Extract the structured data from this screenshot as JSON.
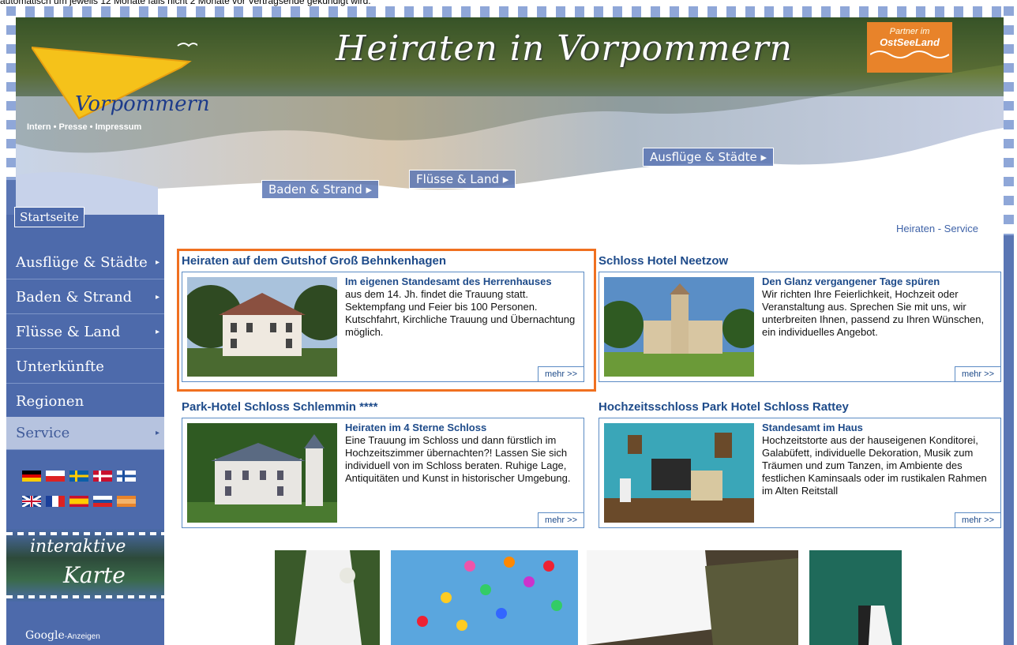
{
  "top_text": "automatisch um jeweils 12 Monate falls nicht 2 Monate vor Vertragsende gekündigt wird.",
  "header": {
    "title": "Heiraten in Vorpommern",
    "logo": "Vorpommern",
    "intern_links": "Intern • Presse • Impressum",
    "partner_line1": "Partner im",
    "partner_line2": "OstSeeLand",
    "buttons": {
      "baden": "Baden & Strand ▸",
      "fluesse": "Flüsse & Land ▸",
      "ausfluege": "Ausflüge & Städte ▸"
    }
  },
  "sidebar": {
    "start": "Startseite",
    "items": [
      {
        "label": "Ausflüge & Städte",
        "arrow": "▸"
      },
      {
        "label": "Baden & Strand",
        "arrow": "▸"
      },
      {
        "label": "Flüsse & Land",
        "arrow": "▸"
      },
      {
        "label": "Unterkünfte",
        "arrow": ""
      },
      {
        "label": "Regionen",
        "arrow": ""
      },
      {
        "label": "Service",
        "arrow": "▸"
      }
    ],
    "karte_line1": "interaktive",
    "karte_line2": "Karte",
    "google": "Google",
    "google_small": "-Anzeigen"
  },
  "breadcrumb": "Heiraten - Service",
  "cards": [
    {
      "title": "Heiraten auf dem Gutshof Groß Behnkenhagen",
      "subtitle": "Im eigenen Standesamt des Herrenhauses",
      "text": "aus dem 14. Jh. findet die Trauung statt. Sektempfang und Feier bis 100 Personen. Kutschfahrt, Kirchliche Trauung und Übernachtung möglich.",
      "more": "mehr >>"
    },
    {
      "title": "Schloss Hotel Neetzow",
      "subtitle": "Den Glanz vergangener Tage spüren",
      "text": "Wir richten Ihre Feierlichkeit, Hochzeit oder Veranstaltung aus. Sprechen Sie mit uns, wir unterbreiten Ihnen, passend zu Ihren Wünschen, ein individuelles Angebot.",
      "more": "mehr >>"
    },
    {
      "title": "Park-Hotel Schloss Schlemmin ****",
      "subtitle": "Heiraten im 4 Sterne Schloss",
      "text": "Eine Trauung im Schloss und dann fürstlich im Hochzeitszimmer übernachten?! Lassen Sie sich individuell von im Schloss beraten. Ruhige Lage, Antiquitäten und Kunst in historischer Umgebung.",
      "more": "mehr >>"
    },
    {
      "title": "Hochzeitsschloss Park Hotel Schloss Rattey",
      "subtitle": "Standesamt im Haus",
      "text": "Hochzeitstorte aus der hauseigenen Konditorei, Galabüfett, individuelle Dekoration, Musik zum Träumen und zum Tanzen, im Ambiente des festlichen Kaminsaals oder im rustikalen Rahmen im Alten Reitstall",
      "more": "mehr >>"
    }
  ],
  "colors": {
    "frame": "#5a76b4",
    "accent": "#f07020",
    "link": "#1e4b8a"
  }
}
